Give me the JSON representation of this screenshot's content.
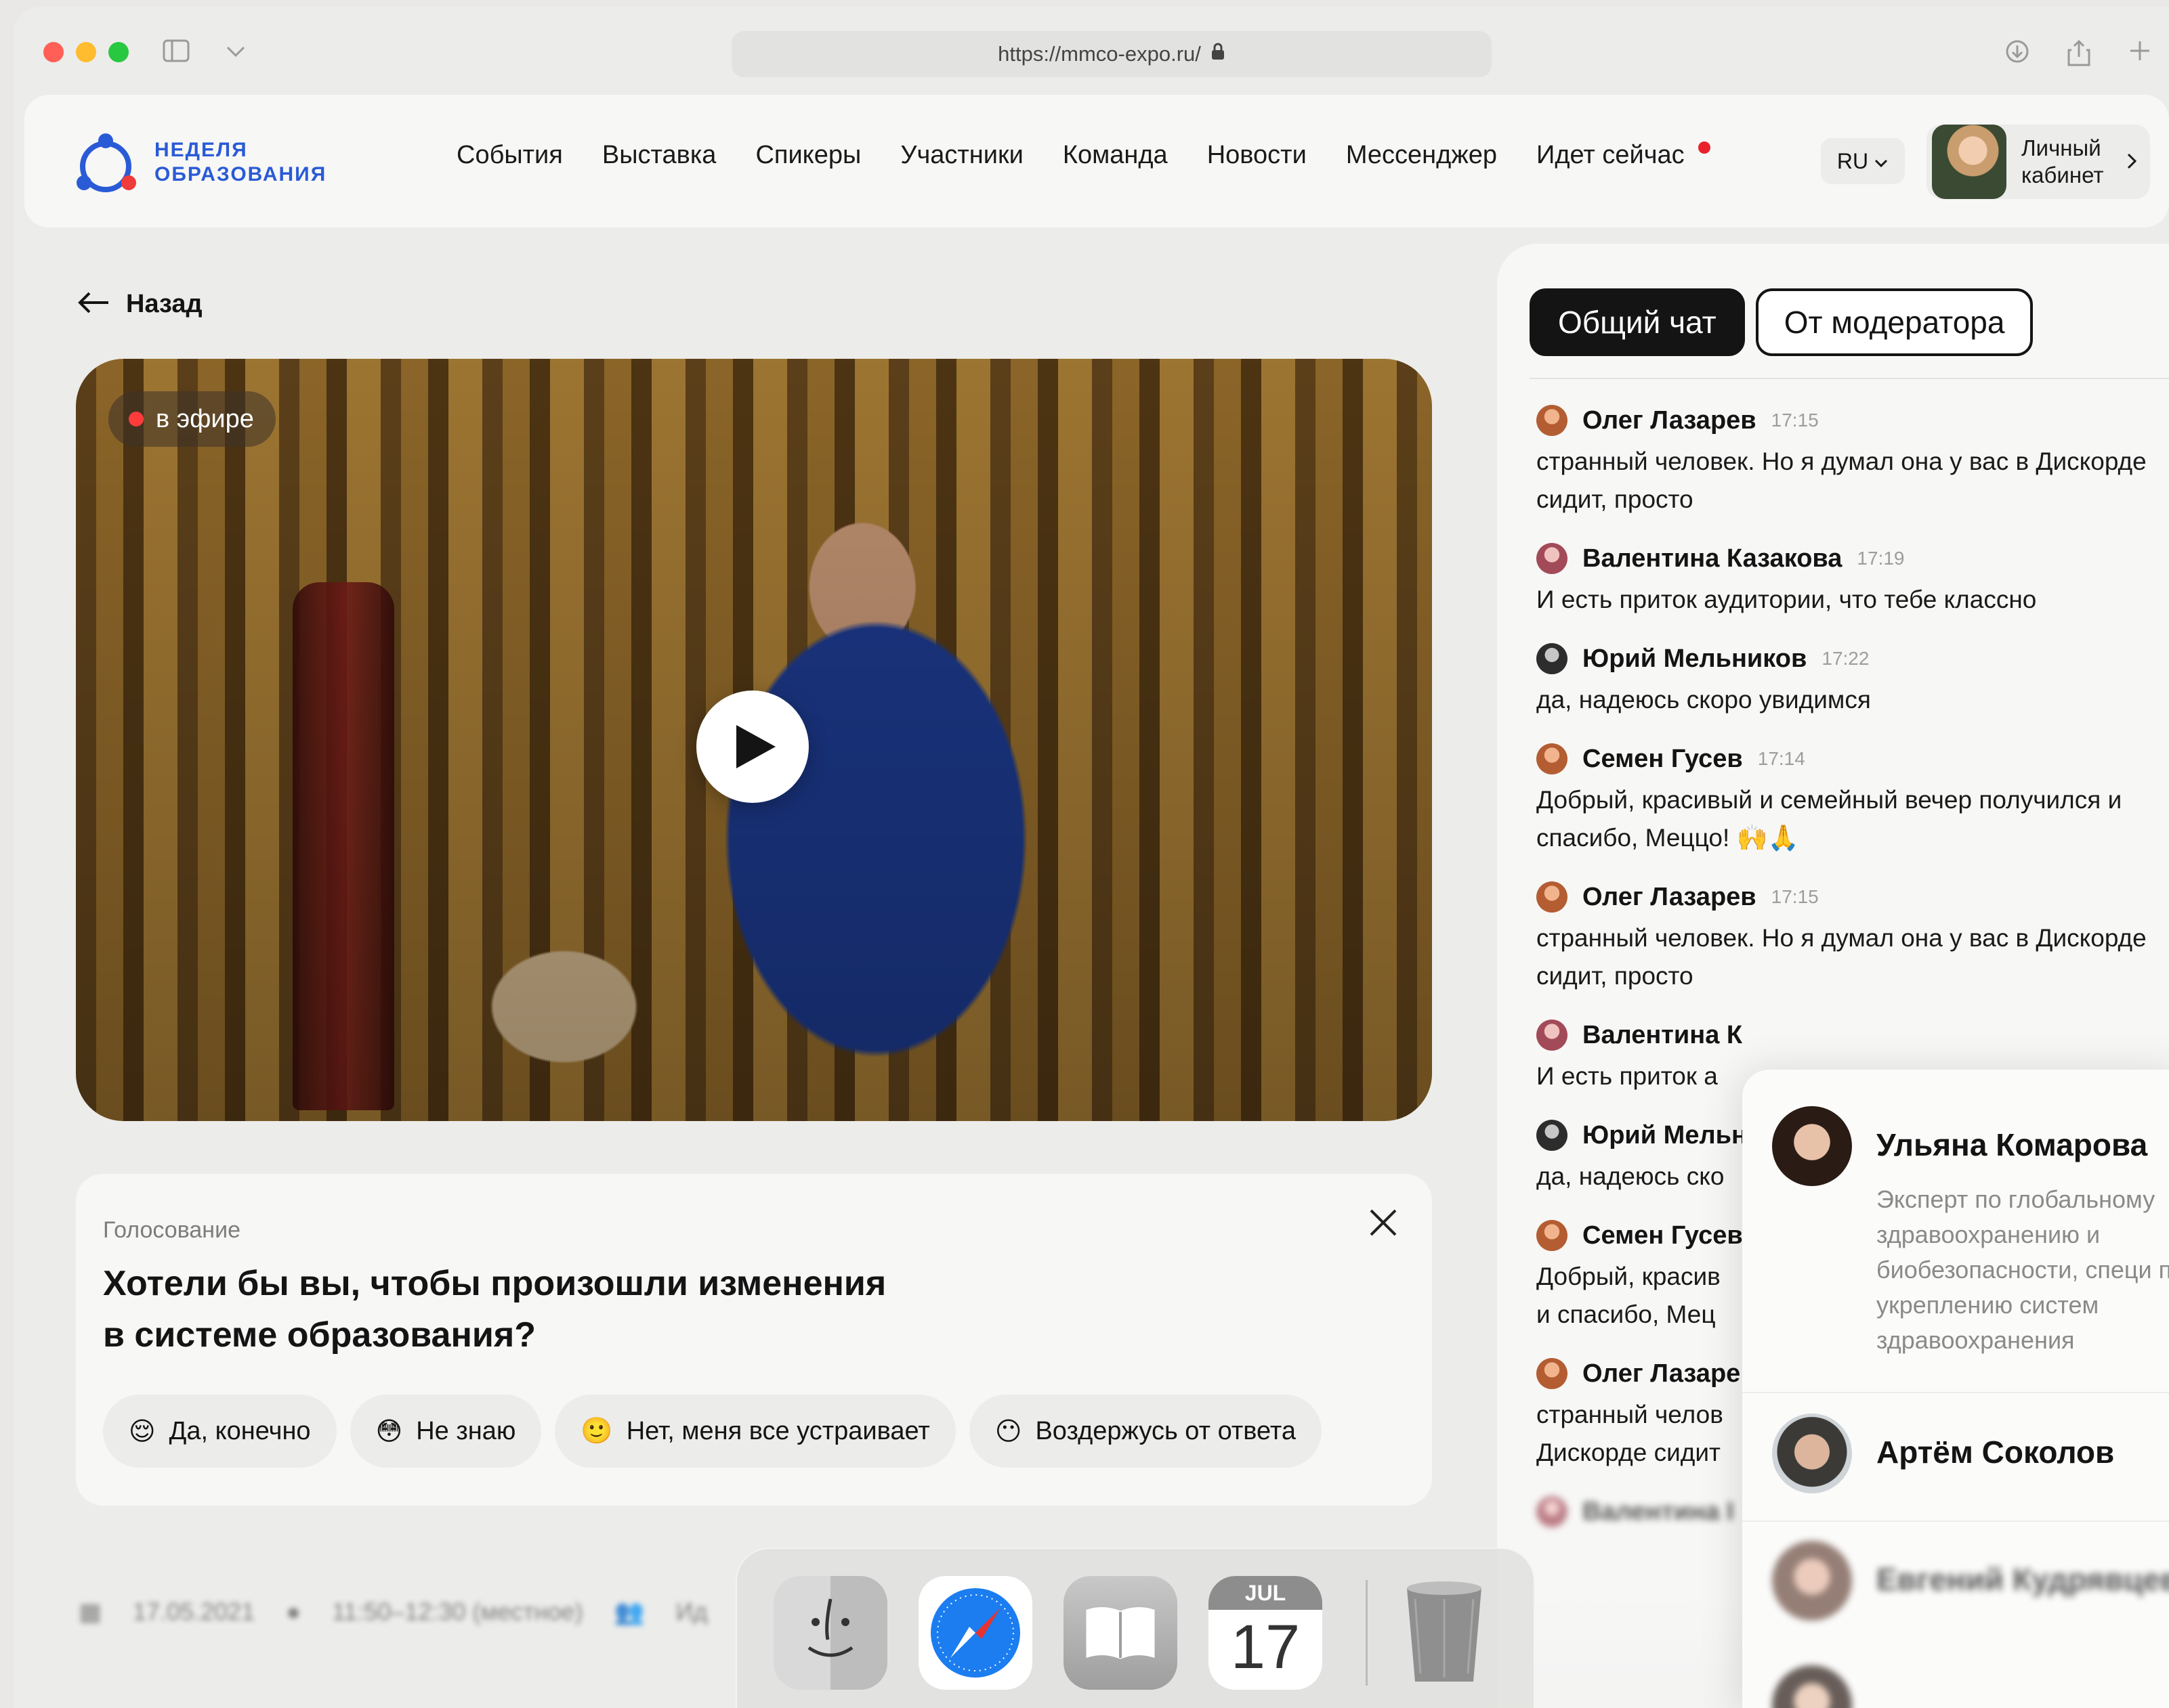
{
  "browser": {
    "url": "https://mmco-expo.ru/"
  },
  "site": {
    "logo_line1": "НЕДЕЛЯ",
    "logo_line2": "ОБРАЗОВАНИЯ",
    "nav": [
      "События",
      "Выставка",
      "Спикеры",
      "Участники",
      "Команда",
      "Новости",
      "Мессенджер",
      "Идет сейчас"
    ],
    "lang": "RU",
    "account_line1": "Личный",
    "account_line2": "кабинет"
  },
  "back_label": "Назад",
  "video": {
    "live_label": "в эфире"
  },
  "poll": {
    "kicker": "Голосование",
    "question_line1": "Хотели бы вы, чтобы произошли изменения",
    "question_line2": "в системе образования?",
    "options": [
      {
        "emoji": "😌",
        "label": "Да, конечно"
      },
      {
        "emoji": "😳",
        "label": "Не знаю"
      },
      {
        "emoji": "🙂",
        "label": "Нет, меня все устраивает"
      },
      {
        "emoji": "😶",
        "label": "Воздержусь от ответа"
      }
    ]
  },
  "meta": {
    "date": "17.05.2021",
    "time": "11:50–12:30 (местное)",
    "extra": "Ид"
  },
  "chat": {
    "tabs": [
      "Общий чат",
      "От модератора"
    ],
    "messages": [
      {
        "name": "Олег Лазарев",
        "time": "17:15",
        "text": "странный человек. Но я думал она у вас в Дискорде сидит, просто"
      },
      {
        "name": "Валентина Казакова",
        "time": "17:19",
        "text": "И есть приток аудитории, что тебе классно"
      },
      {
        "name": "Юрий Мельников",
        "time": "17:22",
        "text": "да, надеюсь скоро увидимся"
      },
      {
        "name": "Семен Гусев",
        "time": "17:14",
        "text": "Добрый, красивый и семейный вечер получился и спасибо, Меццо! 🙌🙏"
      },
      {
        "name": "Олег Лазарев",
        "time": "17:15",
        "text": "странный человек. Но я думал она у вас в Дискорде сидит, просто"
      },
      {
        "name": "Валентина К",
        "time": "",
        "text": "И есть приток а"
      },
      {
        "name": "Юрий Мельн",
        "time": "",
        "text": "да, надеюсь ско"
      },
      {
        "name": "Семен Гусев",
        "time": "",
        "text": "Добрый, красив и спасибо, Мец"
      },
      {
        "name": "Олег Лазаре",
        "time": "",
        "text": "странный челов Дискорде сидит"
      },
      {
        "name": "Валентина I",
        "time": "",
        "text": ""
      }
    ]
  },
  "speakers": [
    {
      "name": "Ульяна Комарова",
      "desc": "Эксперт по глобальному здравоохранению и биобезопасности, специ по укреплению систем здравоохранения"
    },
    {
      "name": "Артём Соколов",
      "desc": ""
    },
    {
      "name": "Евгений Кудрявцев",
      "desc": ""
    }
  ],
  "dock": {
    "calendar_month": "JUL",
    "calendar_day": "17"
  }
}
